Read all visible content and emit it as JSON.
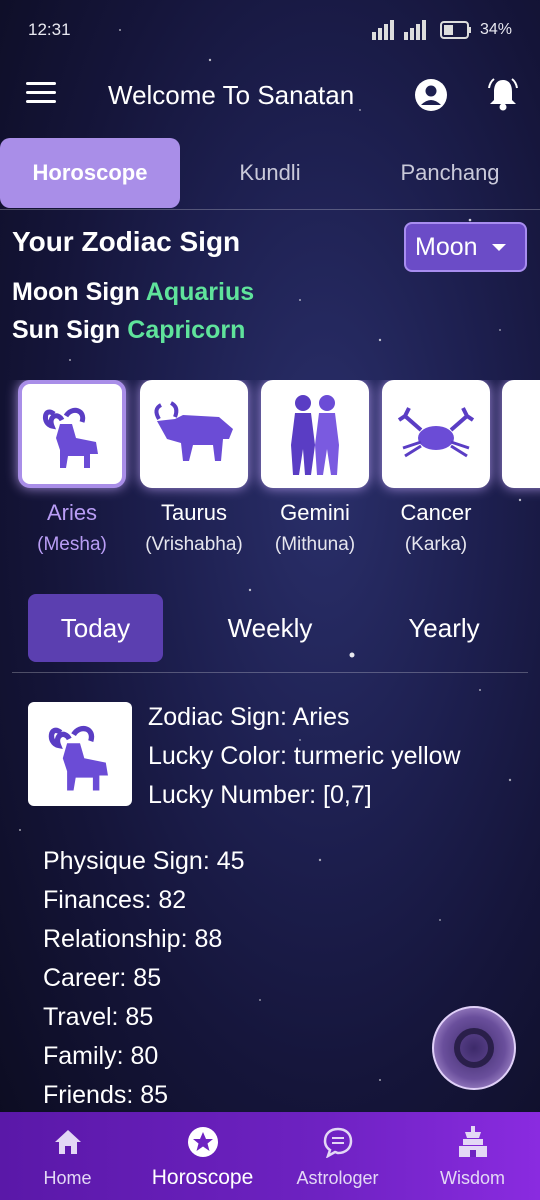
{
  "status_bar": {
    "time": "12:31",
    "battery": "34%"
  },
  "header": {
    "title": "Welcome To Sanatan"
  },
  "tabs": [
    {
      "label": "Horoscope",
      "active": true
    },
    {
      "label": "Kundli",
      "active": false
    },
    {
      "label": "Panchang",
      "active": false
    }
  ],
  "zodiac_section": {
    "heading": "Your Zodiac Sign",
    "moon_sign_label": "Moon Sign",
    "moon_sign_value": "Aquarius",
    "sun_sign_label": "Sun Sign",
    "sun_sign_value": "Capricorn",
    "dropdown_value": "Moon"
  },
  "zodiacs": [
    {
      "name": "Aries",
      "sub": "(Mesha)",
      "icon": "aries-icon",
      "selected": true
    },
    {
      "name": "Taurus",
      "sub": "(Vrishabha)",
      "icon": "taurus-icon",
      "selected": false
    },
    {
      "name": "Gemini",
      "sub": "(Mithuna)",
      "icon": "gemini-icon",
      "selected": false
    },
    {
      "name": "Cancer",
      "sub": "(Karka)",
      "icon": "cancer-icon",
      "selected": false
    }
  ],
  "period_tabs": [
    {
      "label": "Today",
      "active": true
    },
    {
      "label": "Weekly",
      "active": false
    },
    {
      "label": "Yearly",
      "active": false
    }
  ],
  "details": {
    "zodiac_sign": "Zodiac Sign: Aries",
    "lucky_color": "Lucky Color: turmeric yellow",
    "lucky_number": "Lucky Number: [0,7]"
  },
  "stats": [
    "Physique Sign: 45",
    "Finances: 82",
    "Relationship: 88",
    "Career: 85",
    "Travel: 85",
    "Family: 80",
    "Friends: 85"
  ],
  "bottom_nav": [
    {
      "label": "Home",
      "icon": "home-icon",
      "active": false
    },
    {
      "label": "Horoscope",
      "icon": "star-icon",
      "active": true
    },
    {
      "label": "Astrologer",
      "icon": "chat-icon",
      "active": false
    },
    {
      "label": "Wisdom",
      "icon": "temple-icon",
      "active": false
    }
  ],
  "colors": {
    "accent": "#a98ee8",
    "sign_value": "#5fe39b",
    "nav_bg": "#6e22c2"
  }
}
